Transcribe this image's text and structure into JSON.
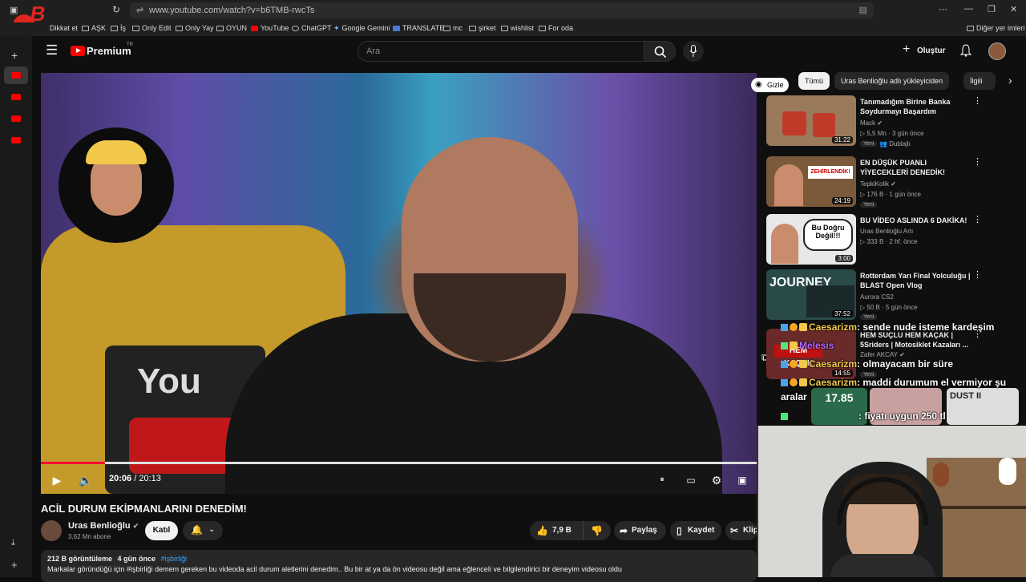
{
  "browser": {
    "url": "www.youtube.com/watch?v=b6TMB-rwcTs",
    "bookmarks": [
      "Dikkat et",
      "AŞK",
      "İş",
      "Only Edit",
      "Only Yay",
      "OYUN",
      "YouTube",
      "ChatGPT",
      "Google Gemini",
      "TRANSLATE",
      "mc",
      "şirket",
      "wishlist",
      "For oda"
    ],
    "other_bookmarks": "Diğer yer imleri"
  },
  "masthead": {
    "logo": "Premium",
    "logo_sup": "TR",
    "search_placeholder": "Ara",
    "create_label": "Oluştur"
  },
  "player": {
    "current_time": "20:06",
    "separator": "/",
    "duration": "20:13",
    "progress": 0.09,
    "hide_label": "Gizle"
  },
  "video": {
    "title": "ACİL DURUM EKİPMANLARINI DENEDİM!",
    "channel": "Uras Benlioğlu",
    "subscribers": "3,62 Mn abone",
    "join_label": "Katıl",
    "likes": "7,9 B",
    "share_label": "Paylaş",
    "save_label": "Kaydet",
    "clip_label": "Klip",
    "views": "212 B görüntüleme",
    "posted": "4 gün önce",
    "hashtag": "#işbirliği",
    "description": "Markalar göründüğü için #işbirliği demem gereken bu videoda acil durum aletlerini denedim.. Bu bir at ya da ön videosu değil ama eğlenceli ve bilgilendirici bir deneyim videosu oldu"
  },
  "chips": [
    "Tümü",
    "Uras Benlioğlu adlı yükleyiciden",
    "İlgili"
  ],
  "related": [
    {
      "title": "Tanımadığım Birine Banka Soydurmayı Başardım",
      "channel": "Mack",
      "meta": "5,5 Mn · 3 gün önce",
      "badge": "Yeni",
      "extra": "Dublajlı",
      "duration": "31:22",
      "thumb_color": "#9a7a5a"
    },
    {
      "title": "EN DÜŞÜK PUANLI YİYECEKLERİ DENEDİK!",
      "channel": "TepkiKolik",
      "meta": "176 B · 1 gün önce",
      "badge": "Yeni",
      "extra": "",
      "duration": "24:19",
      "thumb_color": "#7a5a3a"
    },
    {
      "title": "BU VİDEO ASLINDA 6 DAKİKA!",
      "channel": "Uras Benlioğlu Artı",
      "meta": "333 B · 2 hf. önce",
      "badge": "",
      "extra": "",
      "duration": "3:00",
      "thumb_color": "#e8e8e8"
    },
    {
      "title": "Rotterdam Yarı Final Yolculuğu | BLAST Open Vlog",
      "channel": "Aurora CS2",
      "meta": "50 B · 5 gün önce",
      "badge": "Yeni",
      "extra": "",
      "duration": "37:52",
      "thumb_color": "#2a4a4a"
    },
    {
      "title": "HEM SUÇLU HEM KAÇAK | 5Sriders | Motosiklet Kazaları ...",
      "channel": "Zafer AKCAY",
      "meta": "",
      "badge": "Yeni",
      "extra": "",
      "duration": "14:55",
      "thumb_color": "#6a2a2a"
    }
  ],
  "chat": [
    {
      "user": "Caesarizm",
      "text": ": sende nude isteme kardeşim"
    },
    {
      "user": "Melesis",
      "text": ""
    },
    {
      "user": "Caesarizm",
      "text": ": olmayacam bir süre"
    },
    {
      "user": "Caesarizm",
      "text": ": maddi durumum el vermiyor şu"
    },
    {
      "user": "",
      "text": "aralar"
    },
    {
      "user": "",
      "text": ": fiyatı uygun 250 tl"
    }
  ],
  "colors": {
    "accent": "#ff0033",
    "link": "#3ea6ff",
    "chat_user": "#f2c84a"
  }
}
